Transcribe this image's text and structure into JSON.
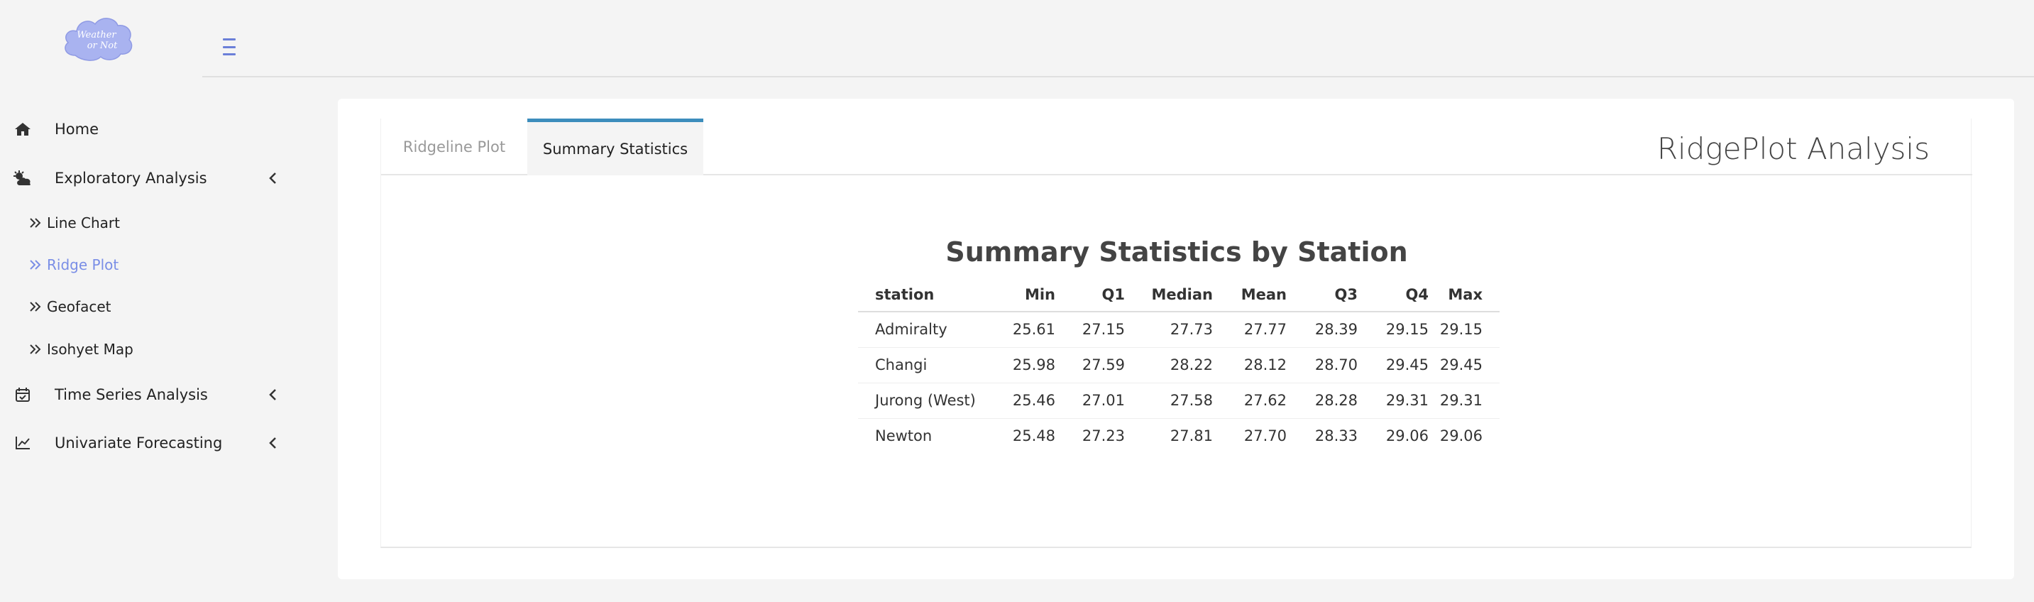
{
  "app": {
    "logo_text_line1": "Weather",
    "logo_text_line2": "or Not",
    "accent_color": "#3c8dbc",
    "active_nav_color": "#7a8ee6"
  },
  "sidebar": {
    "items": [
      {
        "label": "Home",
        "icon": "home-icon"
      },
      {
        "label": "Exploratory Analysis",
        "icon": "cloud-sun-icon",
        "expanded": true,
        "children": [
          {
            "label": "Line Chart"
          },
          {
            "label": "Ridge Plot",
            "active": true
          },
          {
            "label": "Geofacet"
          },
          {
            "label": "Isohyet Map"
          }
        ]
      },
      {
        "label": "Time Series Analysis",
        "icon": "calendar-check-icon"
      },
      {
        "label": "Univariate Forecasting",
        "icon": "line-chart-icon"
      }
    ]
  },
  "main": {
    "tabs": [
      {
        "label": "Ridgeline Plot",
        "active": false
      },
      {
        "label": "Summary Statistics",
        "active": true
      }
    ],
    "panel_title": "RidgePlot Analysis",
    "table_title": "Summary Statistics by Station",
    "table": {
      "headers": [
        "station",
        "Min",
        "Q1",
        "Median",
        "Mean",
        "Q3",
        "Q4",
        "Max"
      ],
      "rows": [
        [
          "Admiralty",
          "25.61",
          "27.15",
          "27.73",
          "27.77",
          "28.39",
          "29.15",
          "29.15"
        ],
        [
          "Changi",
          "25.98",
          "27.59",
          "28.22",
          "28.12",
          "28.70",
          "29.45",
          "29.45"
        ],
        [
          "Jurong (West)",
          "25.46",
          "27.01",
          "27.58",
          "27.62",
          "28.28",
          "29.31",
          "29.31"
        ],
        [
          "Newton",
          "25.48",
          "27.23",
          "27.81",
          "27.70",
          "28.33",
          "29.06",
          "29.06"
        ]
      ]
    }
  }
}
